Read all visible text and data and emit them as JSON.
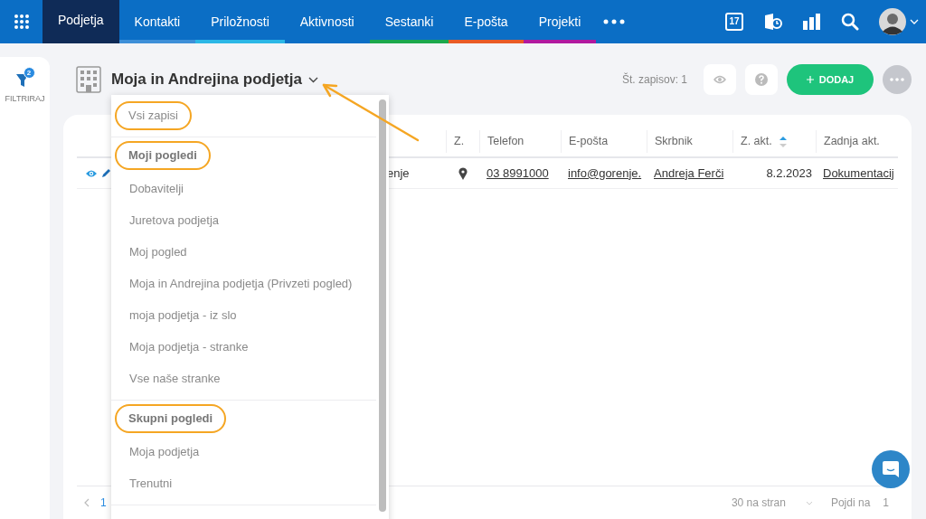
{
  "nav": {
    "tabs": [
      {
        "label": "Podjetja",
        "selected": true,
        "color": "#0f2b57"
      },
      {
        "label": "Kontakti",
        "selected": false,
        "color": "#3d8fd8"
      },
      {
        "label": "Priložnosti",
        "selected": false,
        "color": "#2bb7e6"
      },
      {
        "label": "Aktivnosti",
        "selected": false,
        "color": "#0b6ec5"
      },
      {
        "label": "Sestanki",
        "selected": false,
        "color": "#1ba84c"
      },
      {
        "label": "E-pošta",
        "selected": false,
        "color": "#e95b26"
      },
      {
        "label": "Projekti",
        "selected": false,
        "color": "#b0199f"
      }
    ],
    "calendar_day": "17"
  },
  "sidebar": {
    "filter_count": "2",
    "label": "FILTRIRAJ"
  },
  "header": {
    "title": "Moja in Andrejina podjetja",
    "record_count": "Št. zapisov: 1",
    "add_button": "DODAJ"
  },
  "table": {
    "columns": [
      {},
      {
        "label": "Z."
      },
      {
        "label": "Telefon"
      },
      {
        "label": "E-pošta"
      },
      {
        "label": "Skrbnik"
      },
      {
        "label": "Z. akt.",
        "sort_ascending": true
      },
      {
        "label": "Zadnja akt."
      }
    ],
    "rows": [
      {
        "cells": [
          {
            "kind": "text",
            "text": "enje"
          },
          {
            "kind": "pin"
          },
          {
            "kind": "link",
            "text": "03 8991000"
          },
          {
            "kind": "link",
            "text": "info@gorenje."
          },
          {
            "kind": "link",
            "text": "Andreja Ferči"
          },
          {
            "kind": "date",
            "text": "8.2.2023"
          },
          {
            "kind": "link",
            "text": "Dokumentacij"
          }
        ]
      }
    ]
  },
  "pagination": {
    "page": "1",
    "per_page": "30 na stran",
    "goto_label": "Pojdi na",
    "goto_value": "1"
  },
  "dropdown": {
    "groups": [
      {
        "entries": [
          {
            "kind": "item",
            "label": "Vsi zapisi",
            "circled": true
          }
        ]
      },
      {
        "entries": [
          {
            "kind": "header",
            "label": "Moji pogledi",
            "circled": true
          },
          {
            "kind": "item",
            "label": "Dobavitelji",
            "circled": false
          },
          {
            "kind": "item",
            "label": "Juretova podjetja",
            "circled": false
          },
          {
            "kind": "item",
            "label": "Moj pogled",
            "circled": false
          },
          {
            "kind": "item",
            "label": "Moja in Andrejina podjetja (Privzeti pogled)",
            "circled": false
          },
          {
            "kind": "item",
            "label": "moja podjetja - iz slo",
            "circled": false
          },
          {
            "kind": "item",
            "label": "Moja podjetja - stranke",
            "circled": false
          },
          {
            "kind": "item",
            "label": "Vse naše stranke",
            "circled": false
          }
        ]
      },
      {
        "entries": [
          {
            "kind": "header",
            "label": "Skupni pogledi",
            "circled": true
          },
          {
            "kind": "item",
            "label": "Moja podjetja",
            "circled": false
          },
          {
            "kind": "item",
            "label": "Trenutni",
            "circled": false
          }
        ]
      }
    ]
  }
}
